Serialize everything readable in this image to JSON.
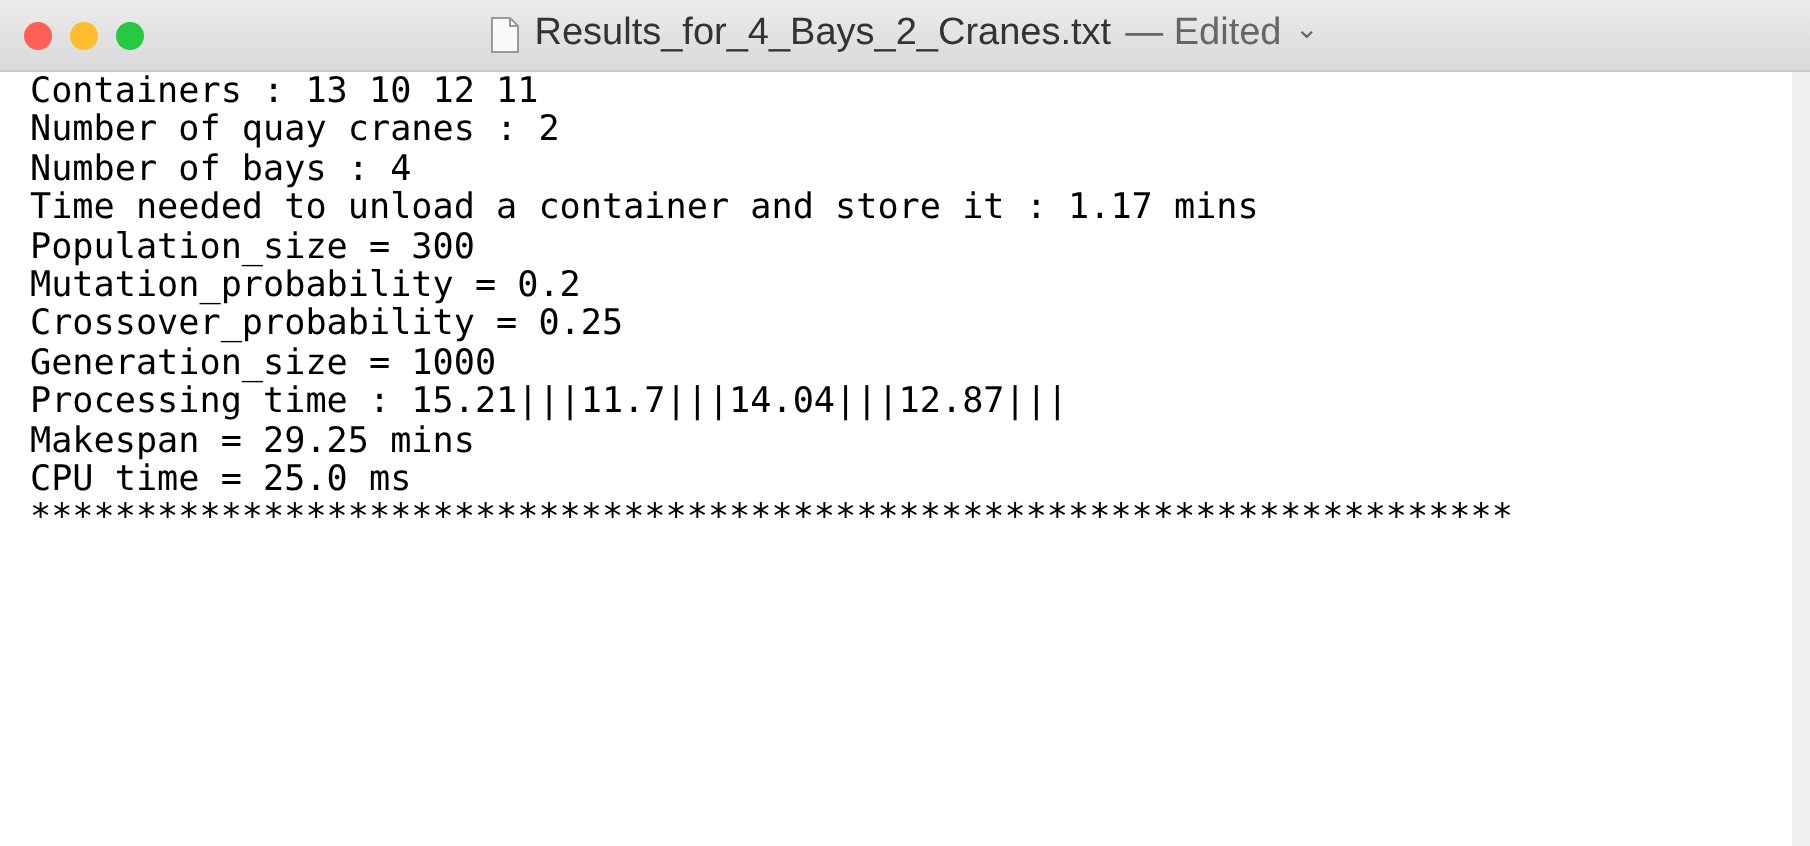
{
  "window": {
    "title": "Results_for_4_Bays_2_Cranes.txt",
    "status": "— Edited",
    "menu_caret": "⌄"
  },
  "lines": [
    "Containers : 13 10 12 11",
    "Number of quay cranes : 2",
    "Number of bays : 4",
    "Time needed to unload a container and store it : 1.17 mins",
    "Population_size = 300",
    "Mutation_probability = 0.2",
    "Crossover_probability = 0.25",
    "Generation_size = 1000",
    "Processing time : 15.21|||11.7|||14.04|||12.87|||",
    "Makespan = 29.25 mins",
    "CPU time = 25.0 ms",
    "**********************************************************************"
  ]
}
